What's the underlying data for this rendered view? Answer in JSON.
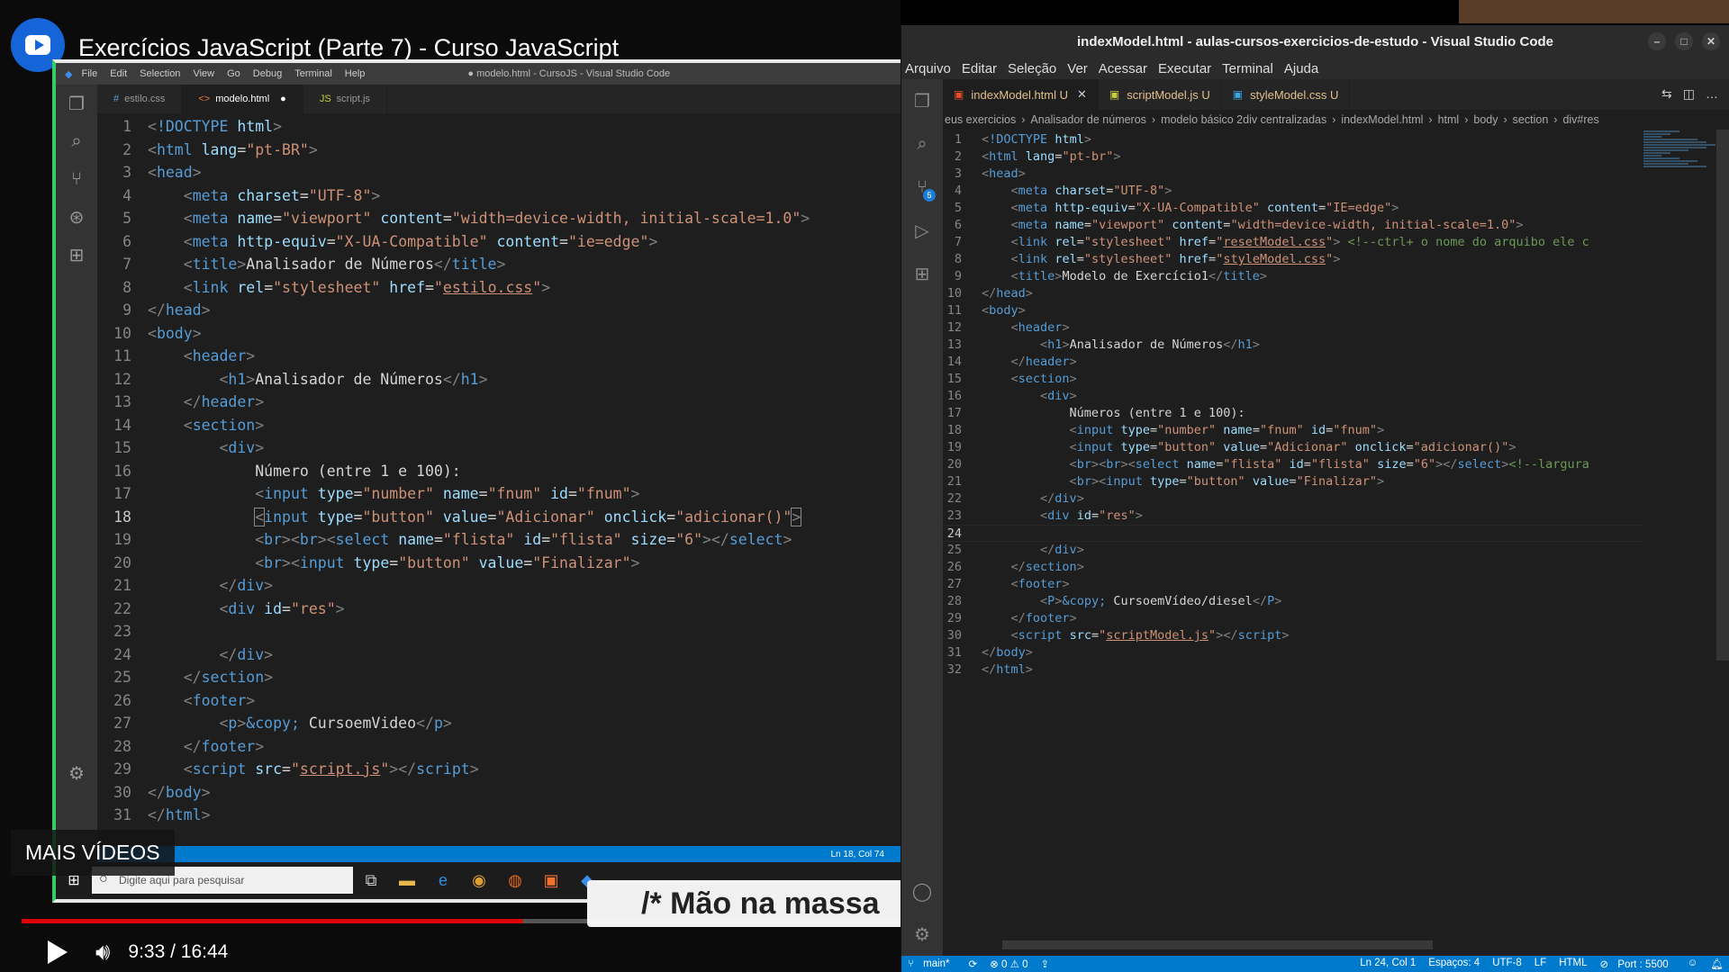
{
  "video": {
    "title": "Exercícios JavaScript (Parte 7) - Curso JavaScript",
    "more_videos": "MAIS VÍDEOS",
    "banner": "/* Mão na massa",
    "time": "9:33 / 16:44",
    "progress_fraction": 0.57
  },
  "inner_vscode": {
    "menu": [
      "File",
      "Edit",
      "Selection",
      "View",
      "Go",
      "Debug",
      "Terminal",
      "Help"
    ],
    "window_title": "● modelo.html - CursoJS - Visual Studio Code",
    "tabs": [
      "estilo.css",
      "modelo.html",
      "script.js"
    ],
    "status": "Ln 18, Col 74",
    "taskbar_search": "Digite aqui para pesquisar"
  },
  "vscode": {
    "title": "indexModel.html - aulas-cursos-exercicios-de-estudo - Visual Studio Code",
    "menu": [
      "Arquivo",
      "Editar",
      "Seleção",
      "Ver",
      "Acessar",
      "Executar",
      "Terminal",
      "Ajuda"
    ],
    "tabs": [
      {
        "label": "indexModel.html",
        "mark": "U"
      },
      {
        "label": "scriptModel.js",
        "mark": "U"
      },
      {
        "label": "styleModel.css",
        "mark": "U"
      }
    ],
    "breadcrumb": [
      "eus exercicios",
      "Analisador de números",
      "modelo básico 2div centralizadas",
      "indexModel.html",
      "html",
      "body",
      "section",
      "div#res"
    ],
    "source_control_badge": "5",
    "status": {
      "branch": "main*",
      "problems": "⊗ 0 ⚠ 0",
      "position": "Ln 24, Col 1",
      "spaces": "Espaços: 4",
      "encoding": "UTF-8",
      "eol": "LF",
      "language": "HTML",
      "port": "Port : 5500"
    }
  },
  "colors": {
    "accent": "#007acc",
    "youtube_red": "#dd0000",
    "editor_bg": "#1e1e1e"
  }
}
